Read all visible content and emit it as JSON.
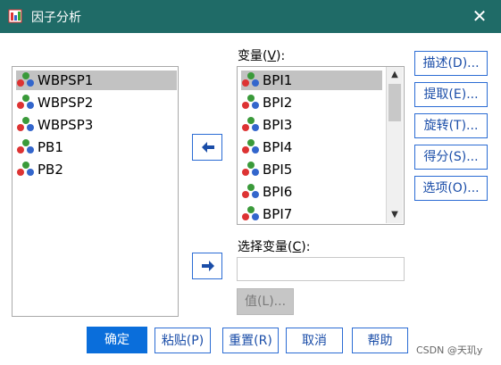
{
  "window": {
    "title": "因子分析",
    "close_icon": "close-icon"
  },
  "source_list": {
    "items": [
      {
        "label": "WBPSP1",
        "selected": true
      },
      {
        "label": "WBPSP2",
        "selected": false
      },
      {
        "label": "WBPSP3",
        "selected": false
      },
      {
        "label": "PB1",
        "selected": false
      },
      {
        "label": "PB2",
        "selected": false
      }
    ]
  },
  "variables": {
    "label_text": "变量(",
    "mnemonic": "V",
    "label_end": "):",
    "items": [
      {
        "label": "BPI1",
        "selected": true
      },
      {
        "label": "BPI2",
        "selected": false
      },
      {
        "label": "BPI3",
        "selected": false
      },
      {
        "label": "BPI4",
        "selected": false
      },
      {
        "label": "BPI5",
        "selected": false
      },
      {
        "label": "BPI6",
        "selected": false
      },
      {
        "label": "BPI7",
        "selected": false
      }
    ]
  },
  "selection_variable": {
    "label_text": "选择变量(",
    "mnemonic": "C",
    "label_end": "):",
    "value": "",
    "value_button": "值(L)..."
  },
  "side_buttons": {
    "describe": "描述(D)...",
    "extract": "提取(E)...",
    "rotate": "旋转(T)...",
    "scores": "得分(S)...",
    "options": "选项(O)..."
  },
  "bottom_buttons": {
    "ok": "确定",
    "paste": "粘贴(P)",
    "reset": "重置(R)",
    "cancel": "取消",
    "help": "帮助"
  },
  "watermark": "CSDN @天玑y",
  "colors": {
    "titlebar": "#1f6b67",
    "accent": "#0a6edb",
    "border": "#2b6cd4"
  }
}
